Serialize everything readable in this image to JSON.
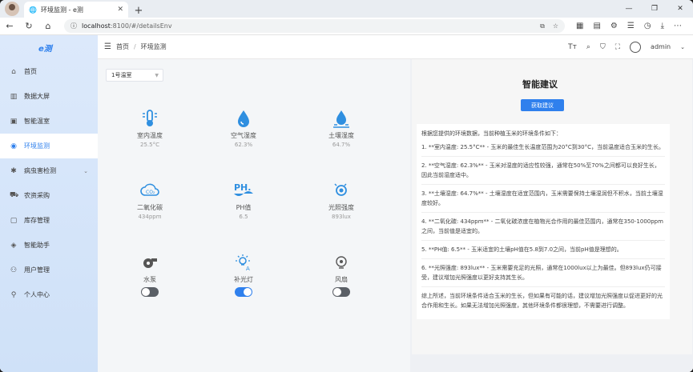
{
  "browser": {
    "tab_title": "环境监测 - e测",
    "url_host": "localhost",
    "url_rest": ":8100/#/detailsEnv"
  },
  "sidebar": {
    "logo": "e测",
    "items": [
      {
        "label": "首页",
        "icon": "home-icon"
      },
      {
        "label": "数据大屏",
        "icon": "chart-icon"
      },
      {
        "label": "智能温室",
        "icon": "greenhouse-icon"
      },
      {
        "label": "环境监测",
        "icon": "monitor-icon",
        "active": true
      },
      {
        "label": "病虫害检测",
        "icon": "bug-icon",
        "has_submenu": true
      },
      {
        "label": "农资采购",
        "icon": "cart-icon"
      },
      {
        "label": "库存管理",
        "icon": "box-icon"
      },
      {
        "label": "智能助手",
        "icon": "assistant-icon"
      },
      {
        "label": "用户管理",
        "icon": "users-icon"
      },
      {
        "label": "个人中心",
        "icon": "user-icon"
      }
    ]
  },
  "header": {
    "breadcrumb": [
      "首页",
      "环境监测"
    ],
    "username": "admin"
  },
  "env": {
    "greenhouse_select": "1号温室",
    "sensors": [
      {
        "label": "室内温度",
        "value": "25.5°C",
        "icon": "thermometer-icon"
      },
      {
        "label": "空气湿度",
        "value": "62.3%",
        "icon": "water-drop-icon"
      },
      {
        "label": "土壤湿度",
        "value": "64.7%",
        "icon": "soil-drop-icon"
      },
      {
        "label": "二氧化碳",
        "value": "434ppm",
        "icon": "co2-icon"
      },
      {
        "label": "PH值",
        "value": "6.5",
        "icon": "ph-icon"
      },
      {
        "label": "光照强度",
        "value": "893lux",
        "icon": "light-sensor-icon"
      }
    ],
    "devices": [
      {
        "label": "水泵",
        "on": false,
        "icon": "pump-icon"
      },
      {
        "label": "补光灯",
        "on": true,
        "icon": "grow-light-icon"
      },
      {
        "label": "风扇",
        "on": false,
        "icon": "fan-icon"
      }
    ]
  },
  "advice": {
    "title": "智能建议",
    "button": "获取建议",
    "intro": "根据您提供的环境数据，当前种植玉米的环境条件如下：",
    "items": [
      "1. **室内温度: 25.5°C** - 玉米的最佳生长温度范围为20°C到30°C，当前温度适合玉米的生长。",
      "2. **空气湿度: 62.3%** - 玉米对湿度的适应性较强，通常在50%至70%之间都可以良好生长，因此当前湿度适中。",
      "3. **土壤湿度: 64.7%** - 土壤湿度在适宜范围内，玉米需要保持土壤湿润但不积水，当前土壤湿度较好。",
      "4. **二氧化碳: 434ppm** - 二氧化碳浓度在植物光合作用的最佳范围内，通常在350-1000ppm之间，当前值是适宜的。",
      "5. **PH值: 6.5** - 玉米适宜的土壤pH值在5.8到7.0之间，当前pH值是理想的。",
      "6. **光照强度: 893lux** - 玉米需要充足的光照，通常在1000lux以上为最佳。但893lux仍可接受，建议增加光照强度以更好支持其生长。"
    ],
    "summary": "综上所述，当前环境条件适合玉米的生长，但如果有可能的话，建议增加光照强度以促进更好的光合作用和生长。如果无法增加光照强度，其他环境条件都很理想，不需要进行调整。"
  }
}
